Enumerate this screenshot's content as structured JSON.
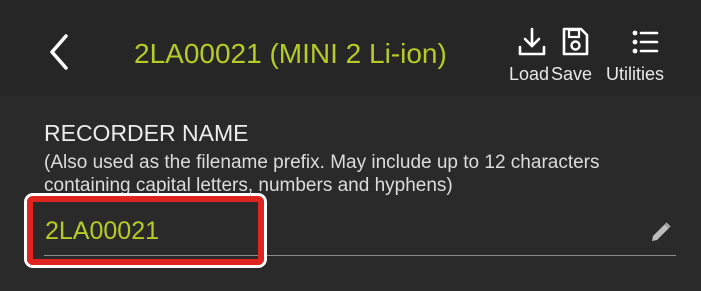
{
  "header": {
    "title": "2LA00021 (MINI 2 Li-ion)",
    "back_icon": "chevron-left-icon",
    "actions": [
      {
        "label": "Load",
        "icon": "download-icon"
      },
      {
        "label": "Save",
        "icon": "save-icon"
      },
      {
        "label": "Utilities",
        "icon": "list-icon"
      }
    ]
  },
  "recorder_name": {
    "title": "RECORDER NAME",
    "help": "(Also used as the filename prefix. May include up to 12 characters containing capital letters, numbers and hyphens)",
    "value": "2LA00021",
    "edit_icon": "pencil-icon"
  },
  "colors": {
    "accent": "#b6cc24",
    "background": "#2a2a2a",
    "header_background": "#262626",
    "highlight": "#e0241f"
  }
}
